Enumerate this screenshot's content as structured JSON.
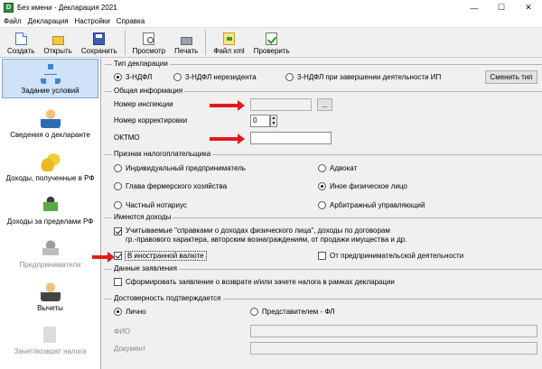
{
  "window": {
    "title": "Без имени - Декларация 2021",
    "app_icon": "D"
  },
  "menu": [
    "Файл",
    "Декларация",
    "Настройки",
    "Справка"
  ],
  "toolbar": {
    "create": "Создать",
    "open": "Открыть",
    "save": "Сохранить",
    "preview": "Просмотр",
    "print": "Печать",
    "xml": "Файл xml",
    "check": "Проверить"
  },
  "sidebar": [
    {
      "label": "Задание условий",
      "icon": "tree-icon",
      "active": true
    },
    {
      "label": "Сведения о декларанте",
      "icon": "person-icon"
    },
    {
      "label": "Доходы, полученные в РФ",
      "icon": "coins-icon"
    },
    {
      "label": "Доходы за пределами РФ",
      "icon": "money-bag-icon"
    },
    {
      "label": "Предприниматели",
      "icon": "business-icon",
      "disabled": true
    },
    {
      "label": "Вычеты",
      "icon": "deduction-icon"
    },
    {
      "label": "Зачет/возврат налога",
      "icon": "refund-icon",
      "disabled": true
    }
  ],
  "decl_type": {
    "title": "Тип декларации",
    "opt1": "3-НДФЛ",
    "opt2": "3-НДФЛ нерезидента",
    "opt3": "3-НДФЛ при завершении деятельности ИП",
    "change_btn": "Сменить тип"
  },
  "general": {
    "title": "Общая информация",
    "inspection_label": "Номер инспекции",
    "inspection_value": "",
    "browse_btn": "...",
    "correction_label": "Номер корректировки",
    "correction_value": "0",
    "oktmo_label": "ОКТМО",
    "oktmo_value": ""
  },
  "taxpayer": {
    "title": "Признак налогоплательщика",
    "ip": "Индивидуальный предприниматель",
    "farm": "Глава фермерского хозяйства",
    "notary": "Частный нотариус",
    "lawyer": "Адвокат",
    "other": "Иное физическое лицо",
    "arbitrage": "Арбитражный управляющий"
  },
  "income": {
    "title": "Имеются доходы",
    "certificates_line1": "Учитываемые \"справками о доходах физического лица\", доходы по договорам",
    "certificates_line2": "гр.-правового характера, авторским вознаграждениям, от продажи имущества и др.",
    "foreign": "В иностранной валюте",
    "business": "От предпринимательской деятельности"
  },
  "statements": {
    "title": "Данные заявления",
    "form_statement": "Сформировать заявление о  возврате и/или зачете налога в рамках декларации"
  },
  "reliability": {
    "title": "Достоверность подтверждается",
    "personal": "Лично",
    "representative": "Представителем - ФЛ",
    "fio_label": "ФИО",
    "doc_label": "Документ"
  },
  "colors": {
    "arrow": "#e21a1a",
    "active_side": "#cfe2f7"
  }
}
